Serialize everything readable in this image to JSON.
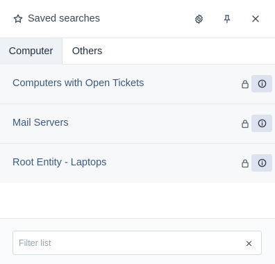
{
  "header": {
    "title": "Saved searches",
    "icons": {
      "title": "star-icon",
      "settings": "gear-icon",
      "pin": "pin-icon",
      "close": "close-icon"
    }
  },
  "tabs": [
    {
      "label": "Computer",
      "active": true
    },
    {
      "label": "Others",
      "active": false
    }
  ],
  "saved_searches": [
    {
      "label": "Computers with Open Tickets",
      "locked": true
    },
    {
      "label": "Mail Servers",
      "locked": true
    },
    {
      "label": "Root Entity - Laptops",
      "locked": true
    }
  ],
  "filter": {
    "placeholder": "Filter list",
    "value": ""
  },
  "colors": {
    "link": "#3b5a7f",
    "info_bg": "#dde3ee",
    "row_bg": "#f7f8fa"
  }
}
